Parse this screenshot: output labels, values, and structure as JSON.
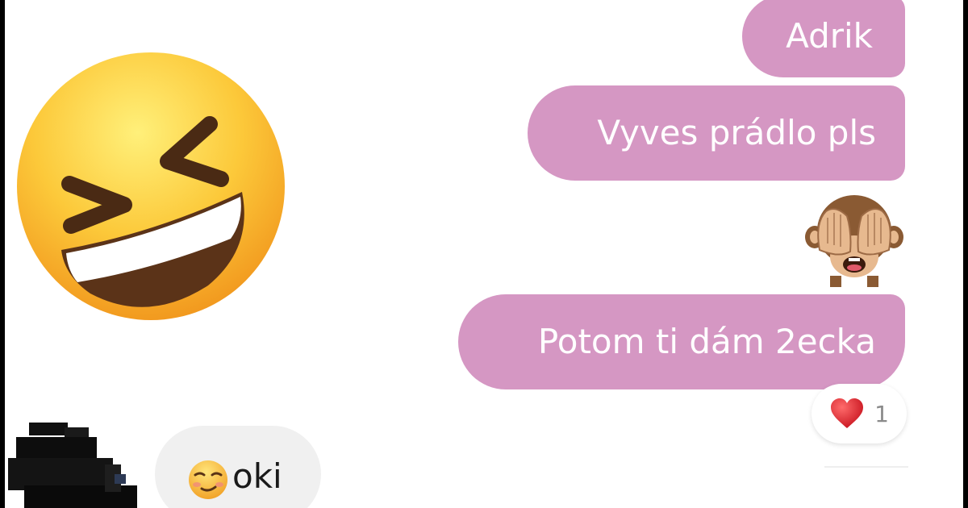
{
  "conversation": {
    "outgoing": [
      {
        "text": "Adrik"
      },
      {
        "text": "Vyves prádlo pls"
      },
      {
        "text": "Potom ti dám 2ecka"
      }
    ],
    "monkey_emoji": "see-no-evil-monkey-icon",
    "reaction": {
      "icon": "heart-icon",
      "count": "1"
    },
    "incoming": [
      {
        "emoji": "relieved-face-icon",
        "text": "oki"
      }
    ]
  },
  "decor": {
    "big_emoji": "laughing-squinting-face-icon"
  },
  "colors": {
    "outgoing_bubble": "#d597c3",
    "incoming_bubble": "#f0f0f0",
    "heart": "#e0242e",
    "page_border": "#000000"
  }
}
